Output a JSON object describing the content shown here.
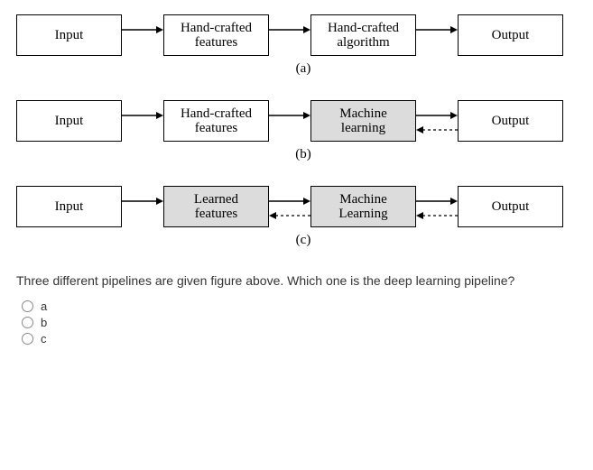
{
  "pipelines": [
    {
      "boxes": [
        {
          "line1": "Input",
          "line2": "",
          "shaded": false
        },
        {
          "line1": "Hand-crafted",
          "line2": "features",
          "shaded": false
        },
        {
          "line1": "Hand-crafted",
          "line2": "algorithm",
          "shaded": false
        },
        {
          "line1": "Output",
          "line2": "",
          "shaded": false
        }
      ],
      "back_arrows": [],
      "caption": "(a)"
    },
    {
      "boxes": [
        {
          "line1": "Input",
          "line2": "",
          "shaded": false
        },
        {
          "line1": "Hand-crafted",
          "line2": "features",
          "shaded": false
        },
        {
          "line1": "Machine",
          "line2": "learning",
          "shaded": true
        },
        {
          "line1": "Output",
          "line2": "",
          "shaded": false
        }
      ],
      "back_arrows": [
        2
      ],
      "caption": "(b)"
    },
    {
      "boxes": [
        {
          "line1": "Input",
          "line2": "",
          "shaded": false
        },
        {
          "line1": "Learned",
          "line2": "features",
          "shaded": true
        },
        {
          "line1": "Machine",
          "line2": "Learning",
          "shaded": true
        },
        {
          "line1": "Output",
          "line2": "",
          "shaded": false
        }
      ],
      "back_arrows": [
        1,
        2
      ],
      "caption": "(c)"
    }
  ],
  "question": "Three different pipelines are given figure above. Which one is the deep learning pipeline?",
  "options": [
    "a",
    "b",
    "c"
  ]
}
